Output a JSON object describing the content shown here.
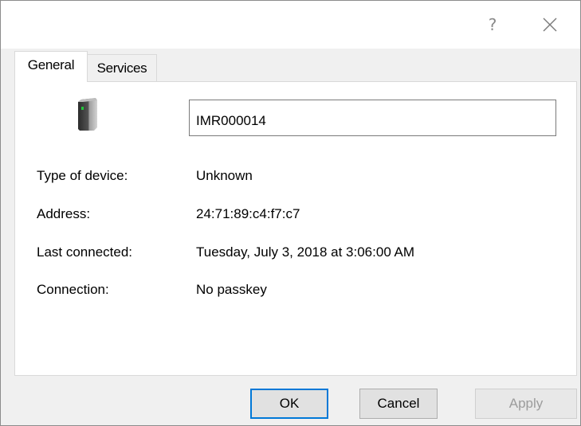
{
  "window": {
    "help_label": "?",
    "close_icon": "close-icon"
  },
  "tabs": [
    {
      "label": "General",
      "active": true
    },
    {
      "label": "Services",
      "active": false
    }
  ],
  "device": {
    "icon": "device-icon",
    "name": "IMR000014"
  },
  "properties": [
    {
      "label": "Type of device:",
      "value": "Unknown"
    },
    {
      "label": "Address:",
      "value": "24:71:89:c4:f7:c7"
    },
    {
      "label": "Last connected:",
      "value": "Tuesday, July 3, 2018 at 3:06:00 AM"
    },
    {
      "label": "Connection:",
      "value": "No passkey"
    }
  ],
  "buttons": {
    "ok": "OK",
    "cancel": "Cancel",
    "apply": "Apply"
  },
  "colors": {
    "accent": "#0078d7",
    "status_led": "#22c43a"
  }
}
